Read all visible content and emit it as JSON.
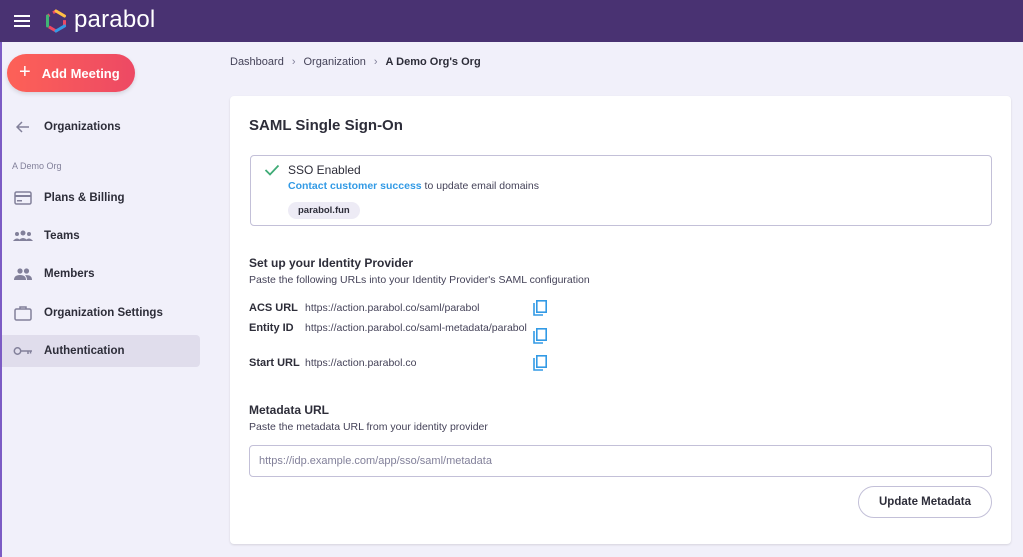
{
  "app": {
    "name": "parabol"
  },
  "sidebar": {
    "add_meeting_label": "Add Meeting",
    "back_label": "Organizations",
    "org_section_label": "A Demo Org",
    "items": [
      {
        "label": "Plans & Billing",
        "icon": "credit-card-icon"
      },
      {
        "label": "Teams",
        "icon": "teams-icon"
      },
      {
        "label": "Members",
        "icon": "members-icon"
      },
      {
        "label": "Organization Settings",
        "icon": "briefcase-icon"
      },
      {
        "label": "Authentication",
        "icon": "key-icon",
        "active": true
      }
    ]
  },
  "breadcrumb": [
    "Dashboard",
    "Organization",
    "A Demo Org's Org"
  ],
  "card": {
    "title": "SAML Single Sign-On",
    "sso": {
      "status": "SSO Enabled",
      "link_text": "Contact customer success",
      "desc_suffix": " to update email domains",
      "domain": "parabol.fun"
    },
    "idp": {
      "title": "Set up your Identity Provider",
      "desc": "Paste the following URLs into your Identity Provider's SAML configuration",
      "urls": [
        {
          "label": "ACS URL",
          "value": "https://action.parabol.co/saml/parabol"
        },
        {
          "label": "Entity ID",
          "value": "https://action.parabol.co/saml-metadata/parabol"
        },
        {
          "label": "Start URL",
          "value": "https://action.parabol.co"
        }
      ]
    },
    "metadata": {
      "title": "Metadata URL",
      "desc": "Paste the metadata URL from your identity provider",
      "placeholder": "https://idp.example.com/app/sso/saml/metadata",
      "button_label": "Update Metadata"
    }
  },
  "colors": {
    "topbar": "#493272",
    "accent_gradient_start": "#fd6157",
    "accent_gradient_end": "#ed4964",
    "link": "#329ae5",
    "success": "#3fab76"
  }
}
